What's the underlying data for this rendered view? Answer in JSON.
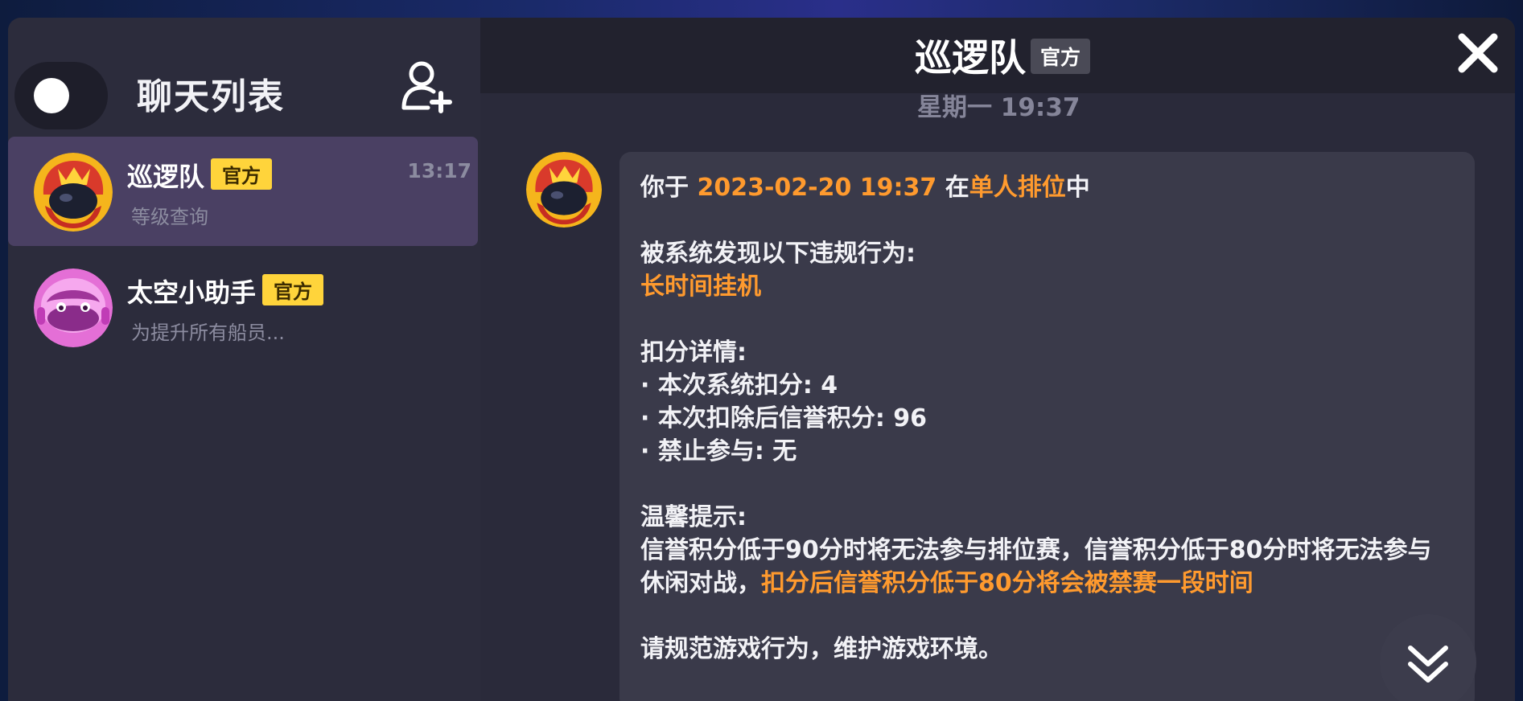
{
  "sidebar": {
    "title": "聊天列表",
    "chats": [
      {
        "name": "巡逻队",
        "tag": "官方",
        "preview": "等级查询",
        "time": "13:17"
      },
      {
        "name": "太空小助手",
        "tag": "官方",
        "preview": "为提升所有船员...",
        "time": ""
      }
    ]
  },
  "header": {
    "title": "巡逻队",
    "tag": "官方"
  },
  "messages": {
    "timestamp": "星期一 19:37",
    "body": {
      "line1_prefix": "你于 ",
      "line1_date": "2023-02-20 19:37",
      "line1_mid": " 在",
      "line1_mode": "单人排位",
      "line1_suffix": "中",
      "violation_heading": "被系统发现以下违规行为:",
      "violation": "长时间挂机",
      "details_heading": "扣分详情:",
      "detail1": "·  本次系统扣分: 4",
      "detail2": "·  本次扣除后信誉积分: 96",
      "detail3": "·  禁止参与: 无",
      "tips_heading": "温馨提示:",
      "tips_text": "信誉积分低于90分时将无法参与排位赛，信誉积分低于80分时将无法参与休闲对战，",
      "tips_highlight": "扣分后信誉积分低于80分将会被禁赛一段时间",
      "closing": "请规范游戏行为，维护游戏环境。"
    }
  },
  "icons": {
    "add_friend": "add-friend-icon",
    "close": "close-icon",
    "scroll_down": "double-chevron-down-icon"
  },
  "colors": {
    "accent_orange": "#ff9a2e",
    "official_tag": "#ffd43b",
    "active_item": "#4a4063"
  }
}
